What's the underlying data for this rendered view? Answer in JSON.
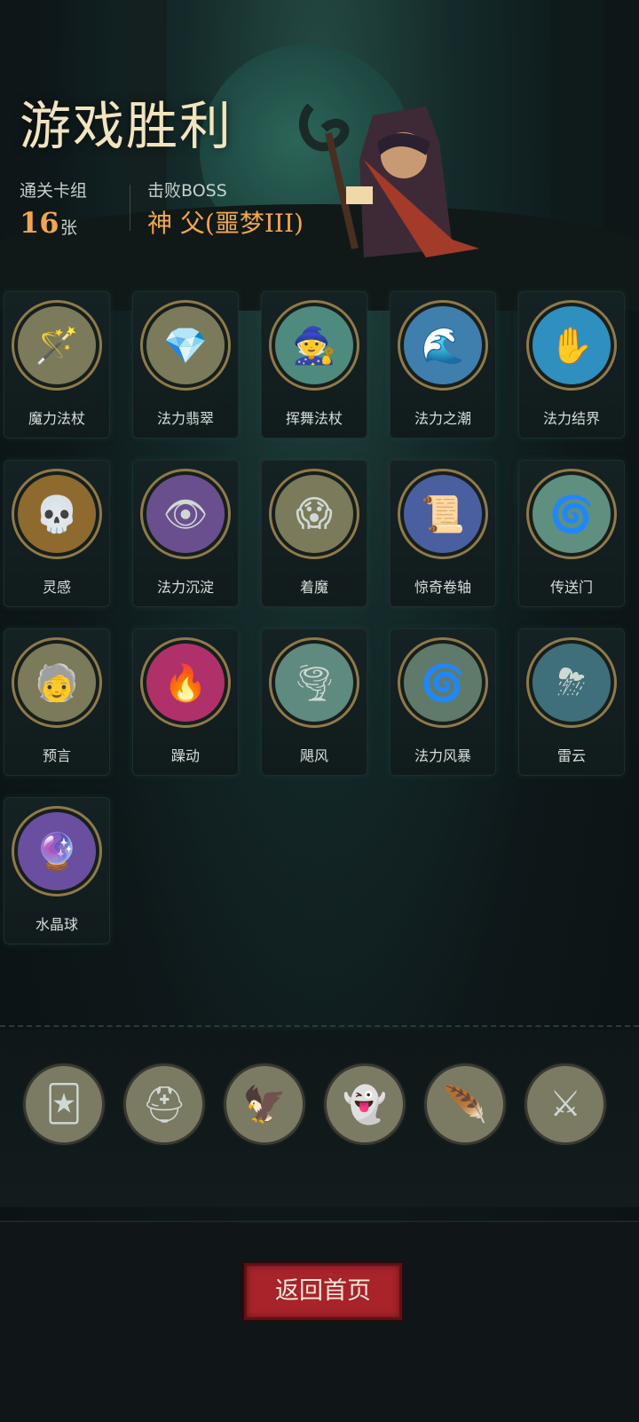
{
  "header": {
    "title": "游戏胜利",
    "cards_label": "通关卡组",
    "cards_count": "16",
    "cards_unit": "张",
    "boss_label": "击败BOSS",
    "boss_name": "神 父(噩梦III)"
  },
  "cards": [
    {
      "name": "魔力法杖",
      "icon": "staff-icon",
      "bg": "#7b7a5a",
      "glyph": "🪄"
    },
    {
      "name": "法力翡翠",
      "icon": "emerald-icon",
      "bg": "#7b7a5a",
      "glyph": "💎"
    },
    {
      "name": "挥舞法杖",
      "icon": "wizard-icon",
      "bg": "#4f8a7f",
      "glyph": "🧙"
    },
    {
      "name": "法力之潮",
      "icon": "wave-icon",
      "bg": "#3f7fae",
      "glyph": "🌊"
    },
    {
      "name": "法力结界",
      "icon": "barrier-icon",
      "bg": "#2f8fbf",
      "glyph": "✋"
    },
    {
      "name": "灵感",
      "icon": "skull-icon",
      "bg": "#8f6a2f",
      "glyph": "💀"
    },
    {
      "name": "法力沉淀",
      "icon": "hooded-spirit-icon",
      "bg": "#6a4f8f",
      "glyph": "👁"
    },
    {
      "name": "着魔",
      "icon": "possessed-icon",
      "bg": "#7b7a5a",
      "glyph": "😱"
    },
    {
      "name": "惊奇卷轴",
      "icon": "scroll-icon",
      "bg": "#4a5fa0",
      "glyph": "📜"
    },
    {
      "name": "传送门",
      "icon": "portal-icon",
      "bg": "#5f8f7f",
      "glyph": "🌀"
    },
    {
      "name": "预言",
      "icon": "prophet-icon",
      "bg": "#7b7a5a",
      "glyph": "🧓"
    },
    {
      "name": "躁动",
      "icon": "frenzy-icon",
      "bg": "#b0306a",
      "glyph": "🔥"
    },
    {
      "name": "飓风",
      "icon": "tornado-icon",
      "bg": "#5f8a7f",
      "glyph": "🌪"
    },
    {
      "name": "法力风暴",
      "icon": "storm-tentacle-icon",
      "bg": "#5f7a6a",
      "glyph": "🌀"
    },
    {
      "name": "雷云",
      "icon": "thundercloud-icon",
      "bg": "#3f6f7a",
      "glyph": "⛈"
    },
    {
      "name": "水晶球",
      "icon": "crystal-ball-icon",
      "bg": "#6a4fa0",
      "glyph": "🔮"
    }
  ],
  "relics": [
    {
      "icon": "tarot-card-relic-icon",
      "glyph": "🃏"
    },
    {
      "icon": "helmet-relic-icon",
      "glyph": "⛑"
    },
    {
      "icon": "eagle-relic-icon",
      "glyph": "🦅"
    },
    {
      "icon": "green-ghost-relic-icon",
      "glyph": "👻"
    },
    {
      "icon": "phoenix-feather-relic-icon",
      "glyph": "🪶"
    },
    {
      "icon": "crossed-staffs-relic-icon",
      "glyph": "⚔"
    }
  ],
  "footer": {
    "home_label": "返回首页"
  },
  "colors": {
    "accent": "#f3a64c",
    "button": "#a8232a"
  }
}
